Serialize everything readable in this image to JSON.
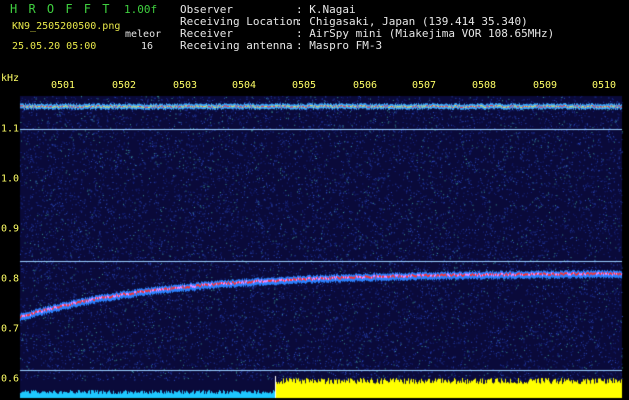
{
  "header": {
    "title": "H R O F F T",
    "version": "1.00f",
    "filename": "KN9_2505200500.png",
    "mode": "meleor",
    "datetime": "25.05.20 05:00",
    "count": "16",
    "info_keys": [
      "Observer",
      "Receiving Location",
      "Receiver",
      "Receiving antenna"
    ],
    "info_values": [
      ": K.Nagai",
      ": Chigasaki, Japan (139.414 35.340)",
      ": AirSpy mini (Miakejima VOR 108.65MHz)",
      ": Maspro FM-3"
    ]
  },
  "spectrogram": {
    "unit": "kHz",
    "time_ticks": [
      "0501",
      "0502",
      "0503",
      "0504",
      "0505",
      "0506",
      "0507",
      "0508",
      "0509",
      "0510"
    ],
    "freq_ticks": [
      "1.1",
      "1.0",
      "0.9",
      "0.8",
      "0.7",
      "0.6"
    ],
    "colors": {
      "background": "#0a0a3a",
      "trace_hot": "#ff3030",
      "reference_line": "#9ad0ff",
      "power_bar": "#ffff00",
      "power_bar_left": "#1ec8ff"
    }
  }
}
